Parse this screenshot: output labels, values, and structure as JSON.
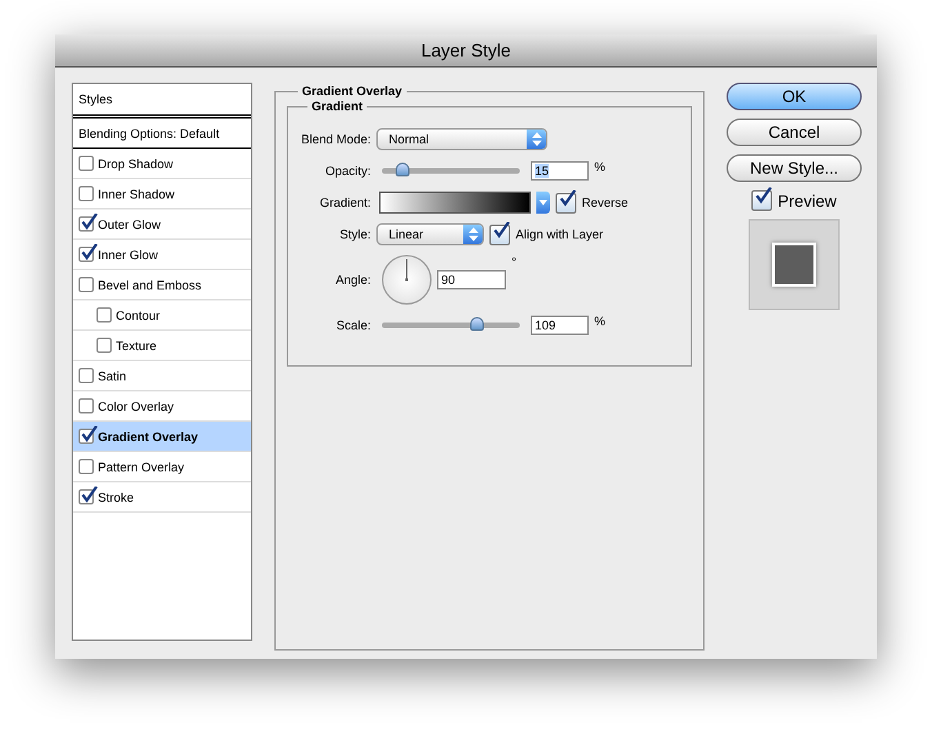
{
  "window": {
    "title": "Layer Style"
  },
  "sidebar": {
    "header": "Styles",
    "items": [
      {
        "label": "Blending Options: Default",
        "kind": "plain",
        "selected": false
      },
      {
        "label": "Drop Shadow",
        "kind": "check",
        "checked": false,
        "selected": false
      },
      {
        "label": "Inner Shadow",
        "kind": "check",
        "checked": false,
        "selected": false
      },
      {
        "label": "Outer Glow",
        "kind": "check",
        "checked": true,
        "selected": false
      },
      {
        "label": "Inner Glow",
        "kind": "check",
        "checked": true,
        "selected": false
      },
      {
        "label": "Bevel and Emboss",
        "kind": "check",
        "checked": false,
        "selected": false,
        "children": [
          {
            "label": "Contour",
            "kind": "check",
            "checked": false,
            "selected": false
          },
          {
            "label": "Texture",
            "kind": "check",
            "checked": false,
            "selected": false
          }
        ]
      },
      {
        "label": "Satin",
        "kind": "check",
        "checked": false,
        "selected": false
      },
      {
        "label": "Color Overlay",
        "kind": "check",
        "checked": false,
        "selected": false
      },
      {
        "label": "Gradient Overlay",
        "kind": "check",
        "checked": true,
        "selected": true
      },
      {
        "label": "Pattern Overlay",
        "kind": "check",
        "checked": false,
        "selected": false
      },
      {
        "label": "Stroke",
        "kind": "check",
        "checked": true,
        "selected": false
      }
    ]
  },
  "panel": {
    "title": "Gradient Overlay",
    "group": "Gradient",
    "blend_mode": {
      "label": "Blend Mode:",
      "value": "Normal"
    },
    "opacity": {
      "label": "Opacity:",
      "level": 0.15,
      "value": "15",
      "unit": "%"
    },
    "gradient": {
      "label": "Gradient:",
      "reverse": {
        "label": "Reverse",
        "checked": true
      }
    },
    "style": {
      "label": "Style:",
      "value": "Linear",
      "align": {
        "label": "Align with Layer",
        "checked": true
      }
    },
    "angle": {
      "label": "Angle:",
      "value": "90",
      "unit": "°"
    },
    "scale": {
      "label": "Scale:",
      "level": 0.69,
      "value": "109",
      "unit": "%"
    }
  },
  "buttons": [
    {
      "label": "OK",
      "default": true
    },
    {
      "label": "Cancel",
      "default": false
    },
    {
      "label": "New Style...",
      "default": false
    }
  ],
  "preview": {
    "label": "Preview",
    "checked": true
  }
}
